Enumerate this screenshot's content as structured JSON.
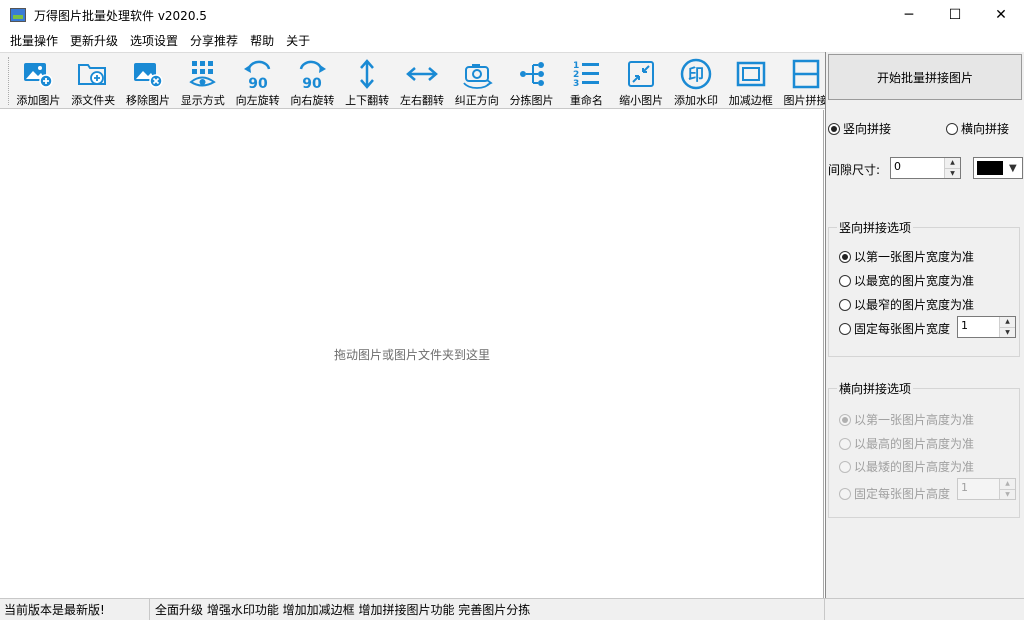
{
  "window": {
    "title": "万得图片批量处理软件 v2020.5",
    "minimize_glyph": "─",
    "maximize_glyph": "☐",
    "close_glyph": "✕"
  },
  "menu": [
    "批量操作",
    "更新升级",
    "选项设置",
    "分享推荐",
    "帮助",
    "关于"
  ],
  "toolbar": {
    "accent": "#1a8ad4",
    "tools": [
      {
        "label": "添加图片",
        "icon": "add-image-icon"
      },
      {
        "label": "添文件夹",
        "icon": "add-folder-icon"
      },
      {
        "label": "移除图片",
        "icon": "remove-image-icon"
      },
      {
        "label": "显示方式",
        "icon": "display-mode-icon"
      },
      {
        "label": "向左旋转",
        "icon": "rotate-left-icon",
        "glyph": "90"
      },
      {
        "label": "向右旋转",
        "icon": "rotate-right-icon",
        "glyph": "90"
      },
      {
        "label": "上下翻转",
        "icon": "flip-vertical-icon"
      },
      {
        "label": "左右翻转",
        "icon": "flip-horizontal-icon"
      },
      {
        "label": "纠正方向",
        "icon": "correct-orientation-icon"
      },
      {
        "label": "分拣图片",
        "icon": "sort-images-icon"
      },
      {
        "label": "重命名",
        "icon": "rename-icon"
      },
      {
        "label": "缩小图片",
        "icon": "shrink-image-icon"
      },
      {
        "label": "添加水印",
        "icon": "watermark-icon",
        "glyph": "印"
      },
      {
        "label": "加减边框",
        "icon": "border-icon"
      },
      {
        "label": "图片拼接",
        "icon": "stitch-icon"
      }
    ]
  },
  "dropzone": {
    "hint": "拖动图片或图片文件夹到这里"
  },
  "panel": {
    "start_button": "开始批量拼接图片",
    "direction": {
      "vertical": "竖向拼接",
      "horizontal": "横向拼接",
      "selected": "vertical"
    },
    "gap": {
      "label": "间隙尺寸:",
      "value": "0",
      "color": "#000000"
    },
    "vertical_group": {
      "title": "竖向拼接选项",
      "options": [
        "以第一张图片宽度为准",
        "以最宽的图片宽度为准",
        "以最窄的图片宽度为准",
        "固定每张图片宽度"
      ],
      "selected": 0,
      "fixed_value": "1",
      "enabled": true
    },
    "horizontal_group": {
      "title": "横向拼接选项",
      "options": [
        "以第一张图片高度为准",
        "以最高的图片高度为准",
        "以最矮的图片高度为准",
        "固定每张图片高度"
      ],
      "selected": 0,
      "fixed_value": "1",
      "enabled": false
    }
  },
  "status": {
    "version_msg": "当前版本是最新版!",
    "update_msg": "全面升级 增强水印功能 增加加减边框 增加拼接图片功能 完善图片分拣"
  }
}
